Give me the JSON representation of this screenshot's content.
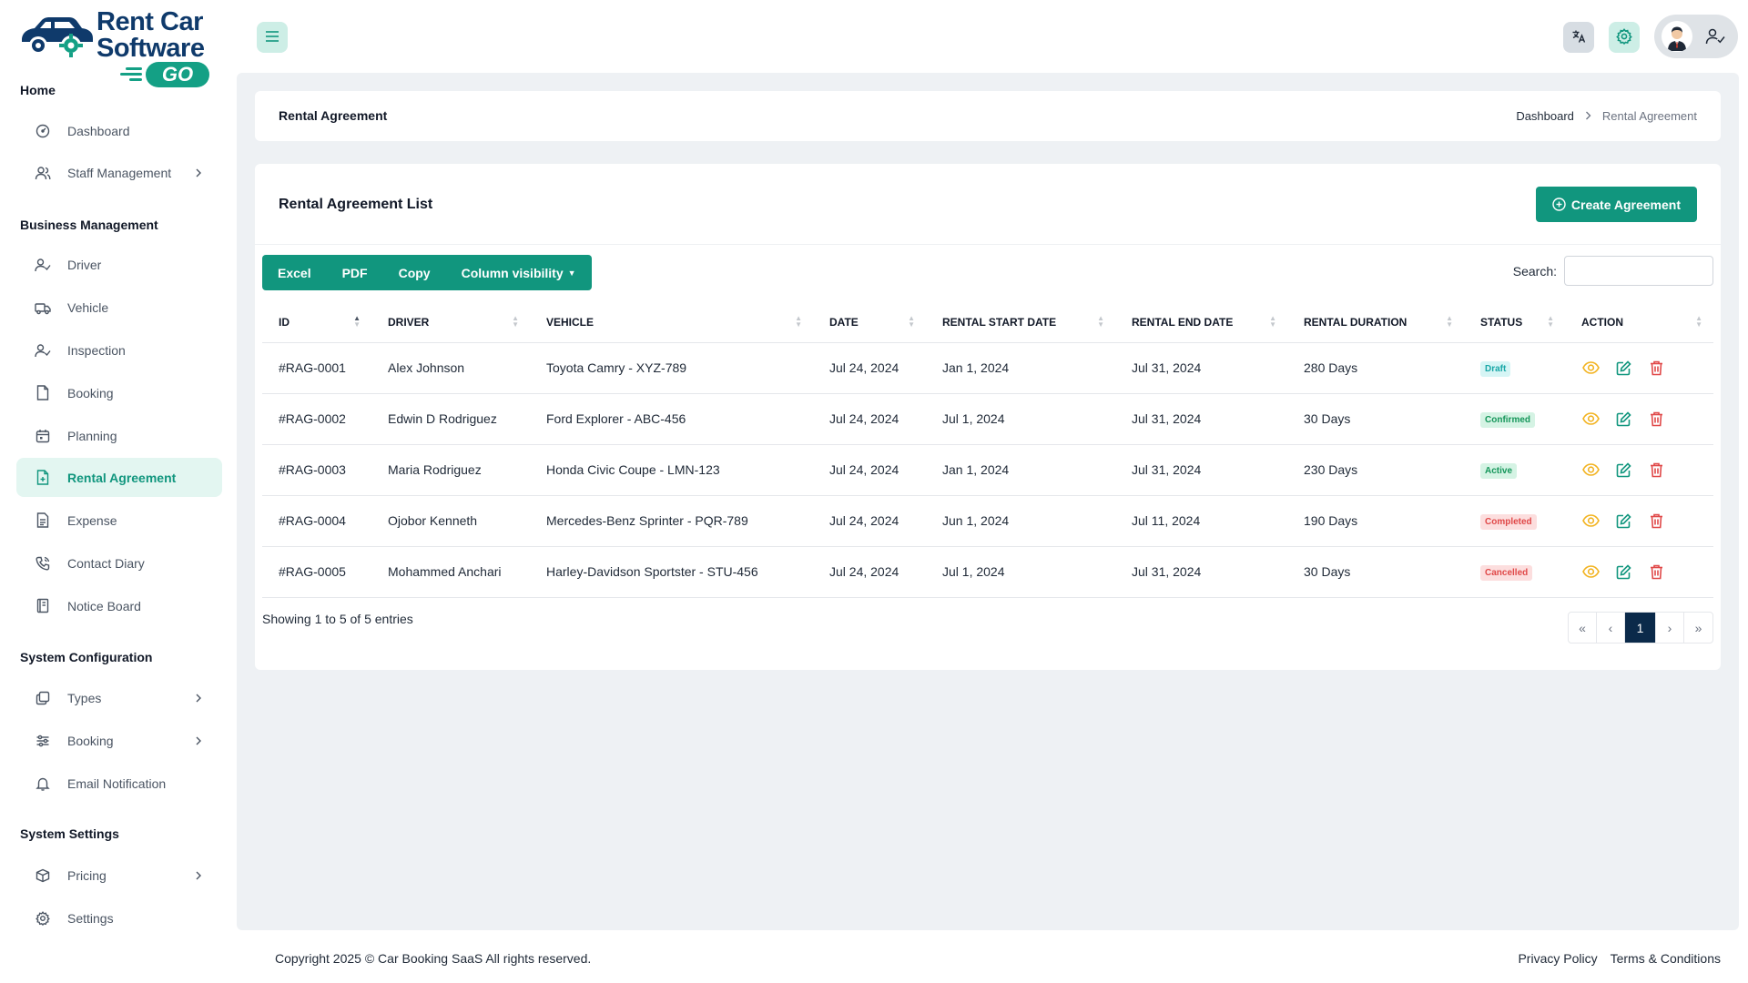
{
  "brand": {
    "line1": "Rent Car",
    "line2": "Software",
    "badge": "GO",
    "color_primary": "#0f3a6b",
    "color_accent": "#14a085"
  },
  "sidebar": {
    "sections": [
      {
        "title": "Home"
      },
      {
        "title": "Business Management"
      },
      {
        "title": "System Configuration"
      },
      {
        "title": "System Settings"
      }
    ],
    "items": [
      {
        "label": "Dashboard",
        "icon": "dashboard-icon"
      },
      {
        "label": "Staff Management",
        "icon": "users-icon",
        "has_submenu": true
      },
      {
        "label": "Driver",
        "icon": "driver-icon"
      },
      {
        "label": "Vehicle",
        "icon": "vehicle-icon"
      },
      {
        "label": "Inspection",
        "icon": "inspection-icon"
      },
      {
        "label": "Booking",
        "icon": "booking-icon"
      },
      {
        "label": "Planning",
        "icon": "calendar-icon"
      },
      {
        "label": "Rental Agreement",
        "icon": "rental-agreement-icon",
        "active": true
      },
      {
        "label": "Expense",
        "icon": "expense-icon"
      },
      {
        "label": "Contact Diary",
        "icon": "phone-icon"
      },
      {
        "label": "Notice Board",
        "icon": "notice-board-icon"
      },
      {
        "label": "Types",
        "icon": "types-icon",
        "has_submenu": true
      },
      {
        "label": "Booking",
        "icon": "sliders-icon",
        "has_submenu": true
      },
      {
        "label": "Email Notification",
        "icon": "bell-icon"
      },
      {
        "label": "Pricing",
        "icon": "box-icon",
        "has_submenu": true
      },
      {
        "label": "Settings",
        "icon": "gear-icon"
      }
    ]
  },
  "topbar": {
    "menu_icon": "hamburger-icon",
    "translate_icon": "translate-icon",
    "settings_icon": "gear-icon",
    "profile_icon": "user-check-icon"
  },
  "page": {
    "title": "Rental Agreement",
    "breadcrumb": {
      "home": "Dashboard",
      "current": "Rental Agreement"
    }
  },
  "list": {
    "title": "Rental Agreement List",
    "create_label": "Create Agreement",
    "export_buttons": [
      "Excel",
      "PDF",
      "Copy",
      "Column visibility"
    ],
    "search_label": "Search:",
    "search_value": "",
    "columns": [
      "ID",
      "DRIVER",
      "VEHICLE",
      "DATE",
      "RENTAL START DATE",
      "RENTAL END DATE",
      "RENTAL DURATION",
      "STATUS",
      "ACTION"
    ],
    "rows": [
      {
        "id": "#RAG-0001",
        "driver": "Alex Johnson",
        "vehicle": "Toyota Camry - XYZ-789",
        "date": "Jul 24, 2024",
        "start": "Jan 1, 2024",
        "end": "Jul 31, 2024",
        "duration": "280 Days",
        "status": "Draft"
      },
      {
        "id": "#RAG-0002",
        "driver": "Edwin D Rodriguez",
        "vehicle": "Ford Explorer - ABC-456",
        "date": "Jul 24, 2024",
        "start": "Jul 1, 2024",
        "end": "Jul 31, 2024",
        "duration": "30 Days",
        "status": "Confirmed"
      },
      {
        "id": "#RAG-0003",
        "driver": "Maria Rodriguez",
        "vehicle": "Honda Civic Coupe - LMN-123",
        "date": "Jul 24, 2024",
        "start": "Jan 1, 2024",
        "end": "Jul 31, 2024",
        "duration": "230 Days",
        "status": "Active"
      },
      {
        "id": "#RAG-0004",
        "driver": "Ojobor Kenneth",
        "vehicle": "Mercedes-Benz Sprinter - PQR-789",
        "date": "Jul 24, 2024",
        "start": "Jun 1, 2024",
        "end": "Jul 11, 2024",
        "duration": "190 Days",
        "status": "Completed"
      },
      {
        "id": "#RAG-0005",
        "driver": "Mohammed Anchari",
        "vehicle": "Harley-Davidson Sportster - STU-456",
        "date": "Jul 24, 2024",
        "start": "Jul 1, 2024",
        "end": "Jul 31, 2024",
        "duration": "30 Days",
        "status": "Cancelled"
      }
    ],
    "status_colors": {
      "Draft": {
        "bg": "#d6f5f5",
        "fg": "#19a7a7"
      },
      "Confirmed": {
        "bg": "#d5f3e4",
        "fg": "#15965a"
      },
      "Active": {
        "bg": "#d5f3e4",
        "fg": "#15965a"
      },
      "Completed": {
        "bg": "#fcdede",
        "fg": "#e04848"
      },
      "Cancelled": {
        "bg": "#fcdede",
        "fg": "#e04848"
      }
    },
    "action_icons": [
      "eye-icon",
      "edit-icon",
      "trash-icon"
    ],
    "showing_text": "Showing 1 to 5 of 5 entries",
    "pagination": {
      "first": "«",
      "prev": "‹",
      "current": "1",
      "next": "›",
      "last": "»"
    }
  },
  "footer": {
    "copyright": "Copyright 2025 © Car Booking SaaS All rights reserved.",
    "links": [
      "Privacy Policy",
      "Terms & Conditions"
    ]
  },
  "colors": {
    "accent": "#11967e",
    "active_bg": "#e3f6f1",
    "content_bg": "#eef1f4",
    "pager_active": "#0b2a4a"
  }
}
